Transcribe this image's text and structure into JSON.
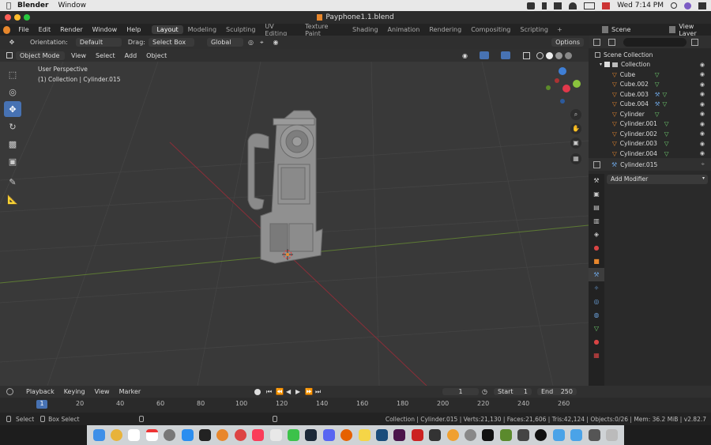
{
  "mac_menubar": {
    "app_name": "Blender",
    "menu": [
      "Window"
    ],
    "clock": "Wed 7:14 PM"
  },
  "window": {
    "title": "Payphone1.1.blend"
  },
  "topbar": {
    "menus": [
      "File",
      "Edit",
      "Render",
      "Window",
      "Help"
    ],
    "workspaces": [
      "Layout",
      "Modeling",
      "Sculpting",
      "UV Editing",
      "Texture Paint",
      "Shading",
      "Animation",
      "Rendering",
      "Compositing",
      "Scripting"
    ],
    "active_workspace": "Layout",
    "scene": "Scene",
    "view_layer": "View Layer"
  },
  "toolrow": {
    "orientation_label": "Orientation:",
    "orientation_value": "Default",
    "drag_label": "Drag:",
    "drag_value": "Select Box",
    "transform_value": "Global",
    "options_label": "Options"
  },
  "header": {
    "mode": "Object Mode",
    "menus": [
      "View",
      "Select",
      "Add",
      "Object"
    ]
  },
  "viewport": {
    "perspective": "User Perspective",
    "collection_info": "(1) Collection | Cylinder.015"
  },
  "outliner": {
    "root": "Scene Collection",
    "collection": "Collection",
    "items": [
      "Cube",
      "Cube.002",
      "Cube.003",
      "Cube.004",
      "Cylinder",
      "Cylinder.001",
      "Cylinder.002",
      "Cylinder.003",
      "Cylinder.004"
    ]
  },
  "properties": {
    "object_name": "Cylinder.015",
    "add_modifier": "Add Modifier"
  },
  "timeline": {
    "menus": [
      "Playback",
      "Keying",
      "View",
      "Marker"
    ],
    "current_frame": "1",
    "start_label": "Start",
    "start_value": "1",
    "end_label": "End",
    "end_value": "250",
    "ruler": [
      "1",
      "20",
      "40",
      "60",
      "80",
      "100",
      "120",
      "140",
      "160",
      "180",
      "200",
      "220",
      "240",
      "260"
    ]
  },
  "statusbar": {
    "select": "Select",
    "box_select": "Box Select",
    "stats": "Collection | Cylinder.015 | Verts:21,130 | Faces:21,606 | Tris:42,124 | Objects:0/26 | Mem: 36.2 MiB | v2.82.7"
  },
  "colors": {
    "accent": "#4772b3",
    "x_axis": "#e0384b",
    "y_axis": "#8bc33d",
    "z_axis": "#3f7fd6",
    "object_orange": "#e8872c",
    "mesh_green": "#6fcf6f"
  }
}
